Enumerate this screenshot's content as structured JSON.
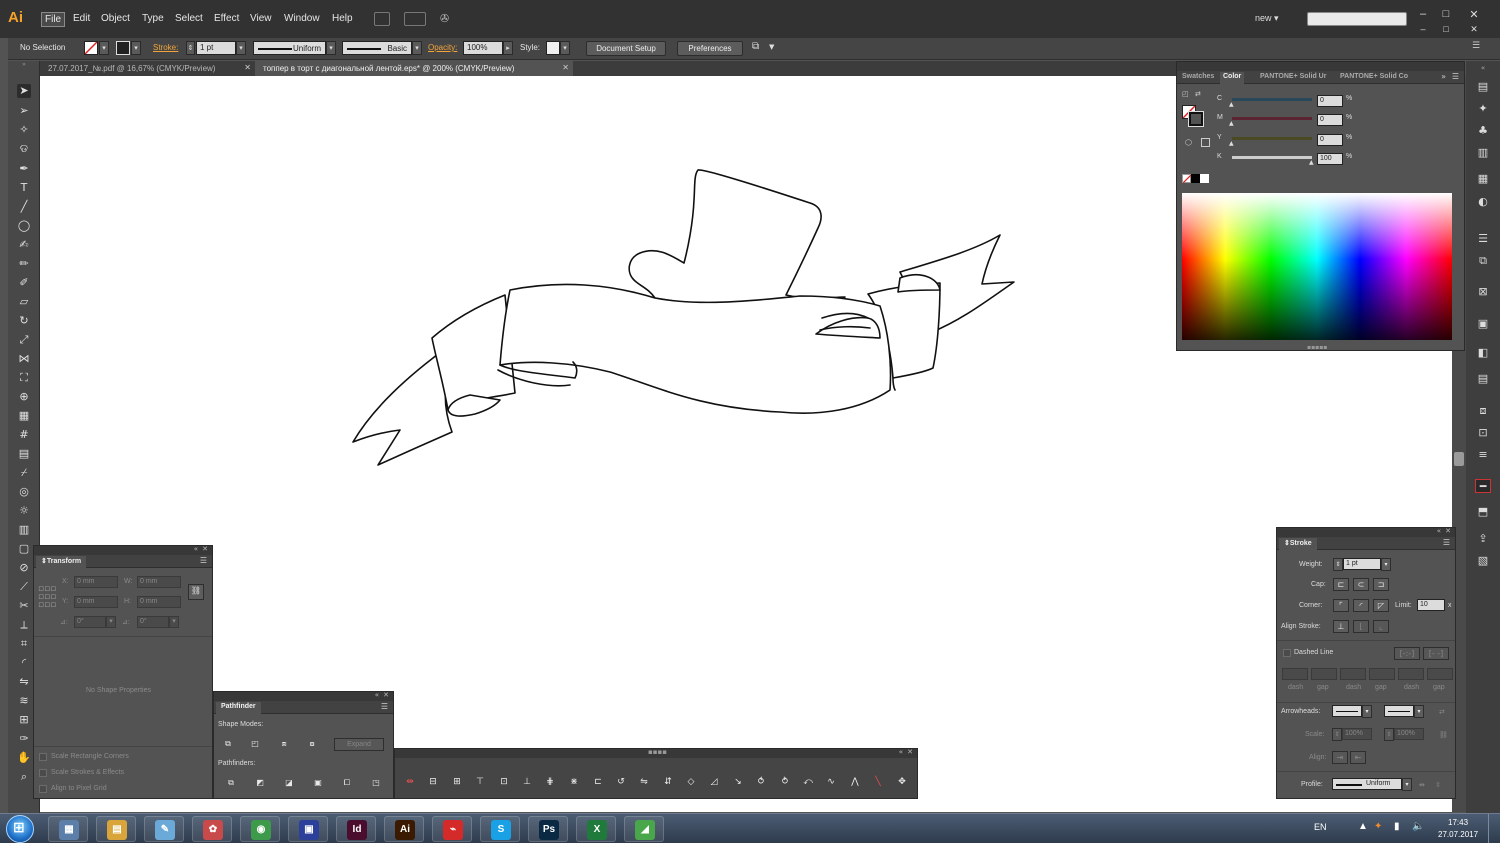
{
  "app": {
    "logo": "Ai",
    "menu": [
      "File",
      "Edit",
      "Object",
      "Type",
      "Select",
      "Effect",
      "View",
      "Window",
      "Help"
    ],
    "active_menu": "File",
    "workspace": "new",
    "window_controls": [
      "–",
      "□",
      "✕"
    ],
    "doc_controls": [
      "–",
      "□",
      "✕"
    ]
  },
  "control_bar": {
    "selection": "No Selection",
    "stroke_label": "Stroke:",
    "stroke_weight": "1 pt",
    "profile": "Uniform",
    "brush": "Basic",
    "opacity_label": "Opacity:",
    "opacity": "100%",
    "style_label": "Style:",
    "document_setup": "Document Setup",
    "preferences": "Preferences"
  },
  "tabs": [
    {
      "label": "27.07.2017_№.pdf @ 16,67% (CMYK/Preview)",
      "active": false
    },
    {
      "label": "топпер в торт с диагональной лентой.eps* @ 200% (CMYK/Preview)",
      "active": true
    }
  ],
  "color_panel": {
    "tabs": [
      "Swatches",
      "Color",
      "PANTONE+ Solid Ur",
      "PANTONE+ Solid Co"
    ],
    "active_tab": "Color",
    "channels": [
      {
        "label": "C",
        "value": "0",
        "unit": "%",
        "fraction": 0.0,
        "color": "#29485a"
      },
      {
        "label": "M",
        "value": "0",
        "unit": "%",
        "fraction": 0.0,
        "color": "#5a2432"
      },
      {
        "label": "Y",
        "value": "0",
        "unit": "%",
        "fraction": 0.0,
        "color": "#4a4a22"
      },
      {
        "label": "K",
        "value": "100",
        "unit": "%",
        "fraction": 1.0,
        "color": "#cccccc"
      }
    ]
  },
  "transform_panel": {
    "title": "Transform",
    "x_label": "X:",
    "x_value": "0 mm",
    "y_label": "Y:",
    "y_value": "0 mm",
    "w_label": "W:",
    "w_value": "0 mm",
    "h_label": "H:",
    "h_value": "0 mm",
    "rotate_value": "0°",
    "shear_value": "0°",
    "no_shape": "No Shape Properties",
    "options": [
      "Scale Rectangle Corners",
      "Scale Strokes & Effects",
      "Align to Pixel Grid"
    ]
  },
  "pathfinder_panel": {
    "title": "Pathfinder",
    "shape_modes": "Shape Modes:",
    "expand": "Expand",
    "pathfinders": "Pathfinders:"
  },
  "stroke_panel": {
    "title": "Stroke",
    "weight_label": "Weight:",
    "weight_value": "1 pt",
    "cap_label": "Cap:",
    "corner_label": "Corner:",
    "limit_label": "Limit:",
    "limit_value": "10",
    "limit_unit": "x",
    "align_label": "Align Stroke:",
    "dashed_label": "Dashed Line",
    "dash_labels": [
      "dash",
      "gap",
      "dash",
      "gap",
      "dash",
      "gap"
    ],
    "arrowheads_label": "Arrowheads:",
    "scale_label": "Scale:",
    "scale_start": "100%",
    "scale_end": "100%",
    "align2_label": "Align:",
    "profile_label": "Profile:",
    "profile_value": "Uniform"
  },
  "taskbar": {
    "language": "EN",
    "time": "17:43",
    "date": "27.07.2017",
    "apps": [
      {
        "name": "calculator",
        "glyph": "▦",
        "bg": "#5b7fa8"
      },
      {
        "name": "explorer",
        "glyph": "▤",
        "bg": "#d9a53a"
      },
      {
        "name": "notepad",
        "glyph": "✎",
        "bg": "#6aa9d8"
      },
      {
        "name": "paint",
        "glyph": "✿",
        "bg": "#c94a4a"
      },
      {
        "name": "chrome",
        "glyph": "◉",
        "bg": "#3c9a4a"
      },
      {
        "name": "save-disk",
        "glyph": "▣",
        "bg": "#2c3f9a"
      },
      {
        "name": "indesign",
        "glyph": "Id",
        "bg": "#4a0d2e"
      },
      {
        "name": "illustrator",
        "glyph": "Ai",
        "bg": "#3a1a00"
      },
      {
        "name": "acrobat",
        "glyph": "⌁",
        "bg": "#d42a2a"
      },
      {
        "name": "skype",
        "glyph": "S",
        "bg": "#1aa0e4"
      },
      {
        "name": "photoshop",
        "glyph": "Ps",
        "bg": "#0a2a44"
      },
      {
        "name": "excel",
        "glyph": "X",
        "bg": "#1f7a3c"
      },
      {
        "name": "green-app",
        "glyph": "◢",
        "bg": "#4aa64a"
      }
    ]
  }
}
